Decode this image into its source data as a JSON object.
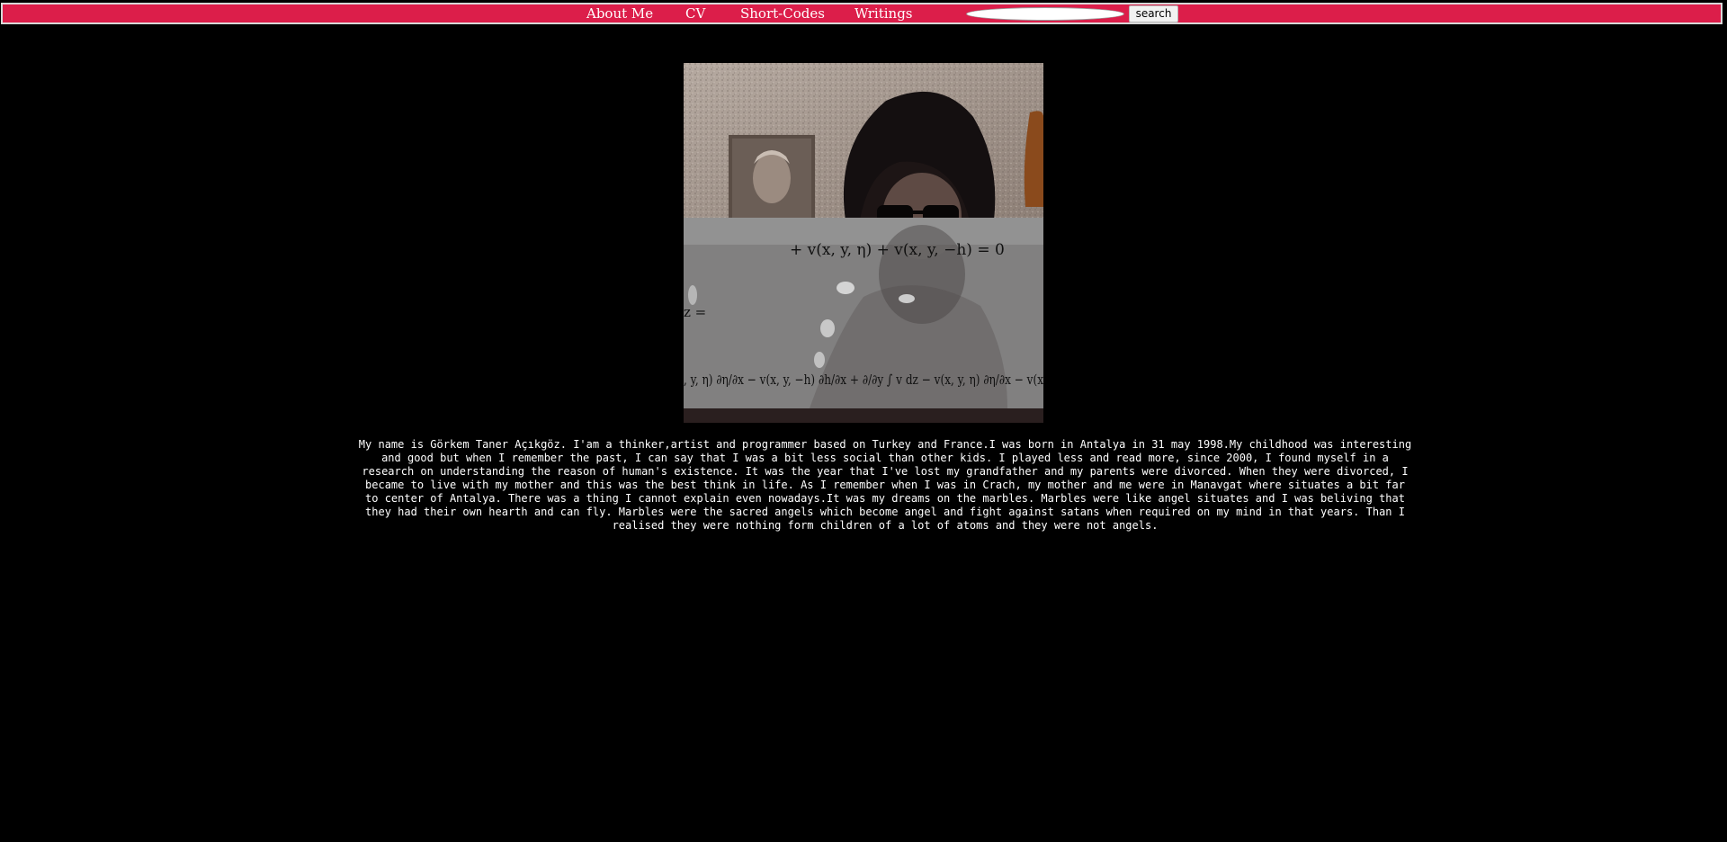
{
  "nav": {
    "links": [
      {
        "label": "About Me"
      },
      {
        "label": "CV"
      },
      {
        "label": "Short-Codes"
      },
      {
        "label": "Writings"
      }
    ],
    "search": {
      "value": "",
      "placeholder": "",
      "button_label": "search"
    }
  },
  "hero": {
    "equations": {
      "line1": "+ v(x, y, η) + v(x, y, −h) = 0",
      "line2": "z =",
      "line3": ", y, η) ∂η/∂x − v(x, y, −h) ∂h/∂x + ∂/∂y ∫ v dz − v(x, y, η) ∂η/∂x − v(x"
    }
  },
  "bio": {
    "text": "My name is Görkem Taner Açıkgöz. I'am a thinker,artist and programmer based on Turkey and France.I was born in Antalya in 31 may 1998.My childhood was interesting and good but when I remember the past, I can say that I was a bit less social than other kids. I played less and read more, since 2000, I found myself in a research on understanding the reason of human's existence. It was the year that I've lost my grandfather and my parents were divorced. When they were divorced, I became to live with my mother and this was the best think in life. As I remember when I was in Crach, my mother and me were in Manavgat where situates a bit far to center of Antalya. There was a thing I cannot explain even nowadays.It was my dreams on the marbles. Marbles were like angel situates and I was beliving that they had their own hearth and can fly. Marbles were the sacred angels which become angel and fight against satans when required on my mind in that years. Than I realised they were nothing form children of a lot of atoms and they were not angels."
  }
}
